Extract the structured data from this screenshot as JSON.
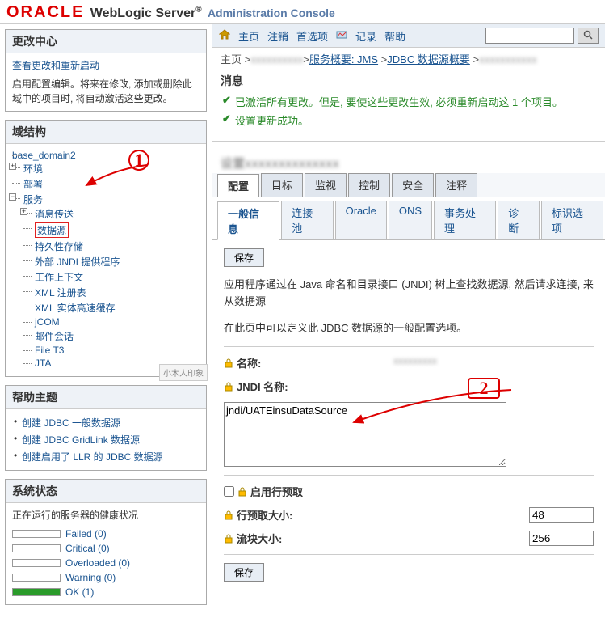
{
  "logo": {
    "brand": "ORACLE",
    "product": "WebLogic Server",
    "suffix": "Administration Console"
  },
  "toolbar": {
    "home": "主页",
    "logout": "注销",
    "prefs": "首选项",
    "record": "记录",
    "help": "帮助",
    "search_placeholder": ""
  },
  "breadcrumb": {
    "home": "主页",
    "svc": "服务概要: JMS",
    "jdbc": "JDBC 数据源概要"
  },
  "messages": {
    "title": "消息",
    "m1": "已激活所有更改。但是, 要使这些更改生效, 必须重新启动这 1 个项目。",
    "m2": "设置更新成功。"
  },
  "left": {
    "change_center": {
      "title": "更改中心",
      "view_restart": "查看更改和重新启动",
      "text": "启用配置编辑。将来在修改, 添加或删除此域中的项目时, 将自动激活这些更改。"
    },
    "domain_struct": {
      "title": "域结构",
      "root": "base_domain2",
      "env": "环境",
      "deploy": "部署",
      "services": "服务",
      "svc_items": {
        "msg": "消息传送",
        "ds": "数据源",
        "pers": "持久性存储",
        "jndi": "外部 JNDI 提供程序",
        "wctx": "工作上下文",
        "xml": "XML 注册表",
        "xmlec": "XML 实体高速缓存",
        "jcom": "jCOM",
        "mail": "邮件会话",
        "filet3": "File T3",
        "jta": "JTA"
      }
    },
    "help": {
      "title": "帮助主题",
      "h1": "创建 JDBC 一般数据源",
      "h2": "创建 JDBC GridLink 数据源",
      "h3": "创建启用了 LLR 的 JDBC 数据源"
    },
    "status": {
      "title": "系统状态",
      "running": "正在运行的服务器的健康状况",
      "failed": "Failed (0)",
      "critical": "Critical (0)",
      "overloaded": "Overloaded (0)",
      "warning": "Warning (0)",
      "ok": "OK (1)"
    }
  },
  "main": {
    "tabs1": [
      "配置",
      "目标",
      "监视",
      "控制",
      "安全",
      "注释"
    ],
    "tabs2": [
      "一般信息",
      "连接池",
      "Oracle",
      "ONS",
      "事务处理",
      "诊断",
      "标识选项"
    ],
    "save": "保存",
    "desc1": "应用程序通过在 Java 命名和目录接口 (JNDI) 树上查找数据源, 然后请求连接, 来从数据源",
    "desc2": "在此页中可以定义此 JDBC 数据源的一般配置选项。",
    "fields": {
      "name_label": "名称:",
      "jndi_label": "JNDI 名称:",
      "jndi_value": "jndi/UATEinsuDataSource",
      "row_prefetch": "启用行预取",
      "prefetch_size_label": "行预取大小:",
      "prefetch_size_value": "48",
      "stream_label": "流块大小:",
      "stream_value": "256"
    }
  },
  "watermark": "小木人印象"
}
